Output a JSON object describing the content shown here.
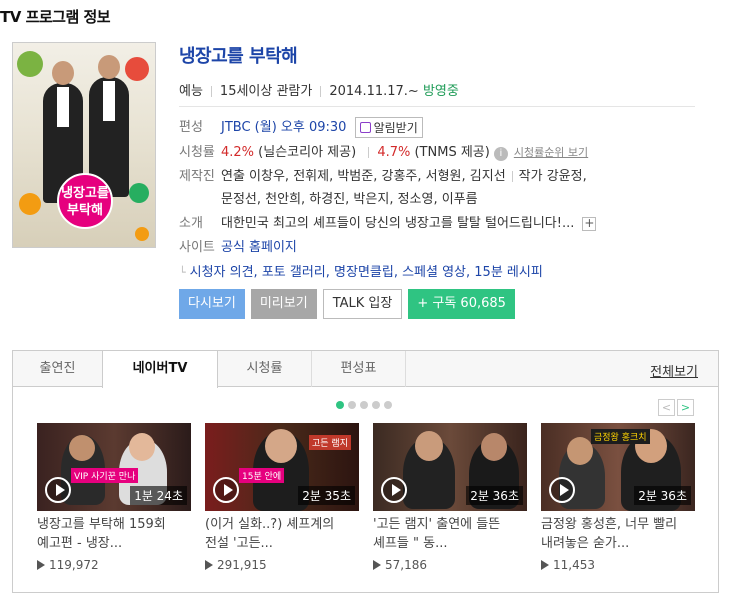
{
  "header": {
    "title": "TV 프로그램 정보"
  },
  "program": {
    "title": "냉장고를 부탁해",
    "poster_badge": "냉장고를 부탁해",
    "genre": "예능",
    "rating": "15세이상 관람가",
    "start_date": "2014.11.17.~",
    "status": "방영중"
  },
  "info": {
    "schedule_label": "편성",
    "schedule_value": "JTBC (월) 오후 09:30",
    "alarm_button": "알림받기",
    "viewer_label": "시청률",
    "viewer_nielsen_value": "4.2%",
    "viewer_nielsen_source": "(닐슨코리아 제공)",
    "viewer_tnms_value": "4.7%",
    "viewer_tnms_source": "(TNMS 제공)",
    "viewer_rank_link": "시청률순위 보기",
    "production_label": "제작진",
    "production_line1": "연출 이창우, 전휘제, 박범준, 강홍주, 서형원, 김지선",
    "production_writer": "작가 강윤정,",
    "production_line2": "문정선, 천안희, 하경진, 박은지, 정소영, 이푸름",
    "intro_label": "소개",
    "intro_value": "대한민국 최고의 셰프들이 당신의 냉장고를 탈탈 털어드립니다!...",
    "site_label": "사이트",
    "site_value": "공식 홈페이지",
    "sub_links": "시청자 의견, 포토 갤러리, 명장면클립, 스페셜 영상, 15분 레시피"
  },
  "buttons": {
    "watch_again": "다시보기",
    "preview": "미리보기",
    "talk": "TALK 입장",
    "subscribe": "+ 구독 60,685"
  },
  "tabs": {
    "items": [
      "출연진",
      "네이버TV",
      "시청률",
      "편성표"
    ],
    "active": "네이버TV",
    "view_all": "전체보기"
  },
  "clips": [
    {
      "title": "냉장고를 부탁해 159회 예고편 - 냉장...",
      "duration": "1분 24초",
      "views": "119,972",
      "caption": "VIP 사기꾼 만나"
    },
    {
      "title": "(이거 실화..?) 셰프계의 전설 '고든...",
      "duration": "2분 35초",
      "views": "291,915",
      "caption": "15분 안에"
    },
    {
      "title": "'고든 램지' 출연에 들뜬 셰프들 \" 동...",
      "duration": "2분 36초",
      "views": "57,186",
      "caption": ""
    },
    {
      "title": "금정왕 홍성흔, 너무 빨리 내려놓은 숟가...",
      "duration": "2분 36초",
      "views": "11,453",
      "caption": "금정왕 홍크치"
    }
  ],
  "colors": {
    "link_blue": "#1d45a8",
    "green": "#2fc482",
    "red": "#d32b2b"
  },
  "icons": [
    "calendar-icon",
    "info-icon",
    "plus-icon",
    "play-icon",
    "prev-arrow-icon",
    "next-arrow-icon"
  ]
}
